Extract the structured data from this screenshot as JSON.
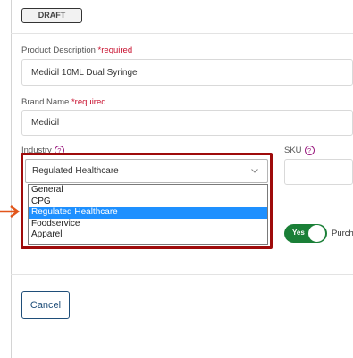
{
  "status_badge": "DRAFT",
  "product_description": {
    "label": "Product Description",
    "required": "*required",
    "value": "Medicil 10ML Dual Syringe"
  },
  "brand_name": {
    "label": "Brand Name",
    "required": "*required",
    "value": "Medicil"
  },
  "industry": {
    "label": "Industry",
    "help": "?",
    "selected": "Regulated Healthcare",
    "options": [
      "General",
      "CPG",
      "Regulated Healthcare",
      "Foodservice",
      "Apparel"
    ]
  },
  "sku": {
    "label": "SKU",
    "help": "?",
    "value": ""
  },
  "purchase_toggle": {
    "state": "Yes",
    "label": "Purcha"
  },
  "cancel_label": "Cancel",
  "colors": {
    "required": "#c8102e",
    "highlight_border": "#9e0b0b",
    "selected_option": "#1e90ff",
    "toggle_on": "#1a7f37",
    "button_outline": "#1f4e79"
  },
  "icons": [
    "help-icon",
    "chevron-down-icon",
    "pointer-arrow-icon"
  ]
}
